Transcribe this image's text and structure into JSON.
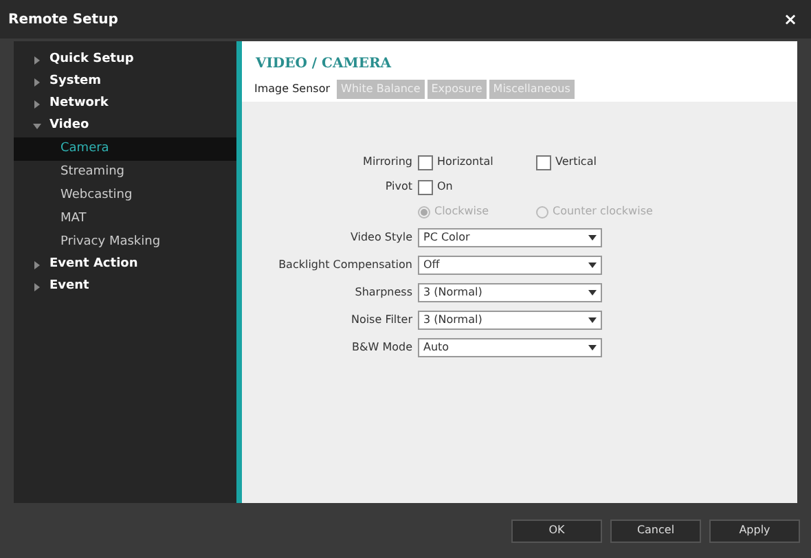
{
  "window": {
    "title": "Remote Setup",
    "close": "×"
  },
  "sidebar": {
    "items": [
      {
        "label": "Quick Setup",
        "expanded": false,
        "selected": false
      },
      {
        "label": "System",
        "expanded": false,
        "selected": false
      },
      {
        "label": "Network",
        "expanded": false,
        "selected": false
      },
      {
        "label": "Video",
        "expanded": true,
        "selected": false,
        "children": [
          {
            "label": "Camera",
            "selected": true
          },
          {
            "label": "Streaming",
            "selected": false
          },
          {
            "label": "Webcasting",
            "selected": false
          },
          {
            "label": "MAT",
            "selected": false
          },
          {
            "label": "Privacy Masking",
            "selected": false
          }
        ]
      },
      {
        "label": "Event Action",
        "expanded": false,
        "selected": false
      },
      {
        "label": "Event",
        "expanded": false,
        "selected": false
      }
    ]
  },
  "page_title": "VIDEO / CAMERA",
  "tabs": [
    {
      "label": "Image Sensor",
      "selected": true
    },
    {
      "label": "White Balance",
      "selected": false
    },
    {
      "label": "Exposure",
      "selected": false
    },
    {
      "label": "Miscellaneous",
      "selected": false
    }
  ],
  "mirroring": {
    "label": "Mirroring",
    "options": [
      {
        "label": "Horizontal",
        "checked": false
      },
      {
        "label": "Vertical",
        "checked": false
      }
    ]
  },
  "pivot": {
    "label": "Pivot",
    "option": {
      "label": "On",
      "checked": false
    },
    "directions": [
      {
        "label": "Clockwise",
        "selected": true,
        "disabled": true
      },
      {
        "label": "Counter clockwise",
        "selected": false,
        "disabled": true
      }
    ]
  },
  "selects": [
    {
      "label": "Video Style",
      "value": "PC Color"
    },
    {
      "label": "Backlight Compensation",
      "value": "Off"
    },
    {
      "label": "Sharpness",
      "value": "3 (Normal)"
    },
    {
      "label": "Noise Filter",
      "value": "3 (Normal)"
    },
    {
      "label": "B&W Mode",
      "value": "Auto"
    }
  ],
  "buttons": [
    "OK",
    "Cancel",
    "Apply"
  ]
}
